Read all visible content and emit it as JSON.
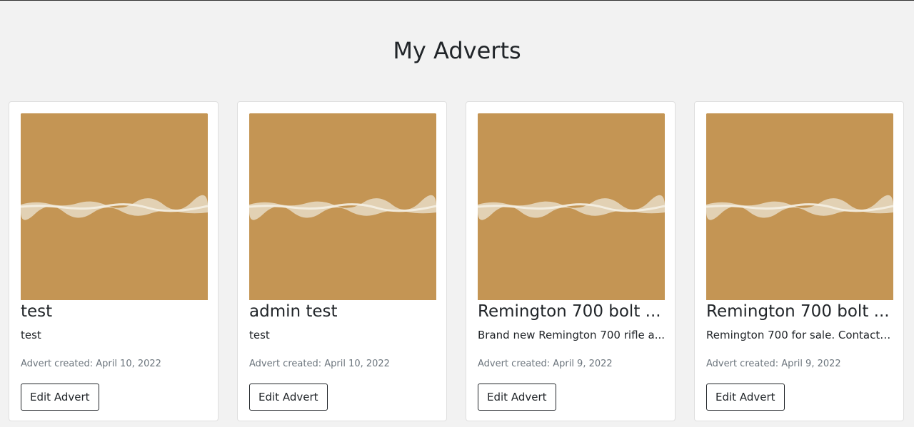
{
  "page": {
    "title": "My Adverts"
  },
  "adverts": [
    {
      "title": "test",
      "description": "test",
      "created": "Advert created: April 10, 2022",
      "edit_label": "Edit Advert"
    },
    {
      "title": "admin test",
      "description": "test",
      "created": "Advert created: April 10, 2022",
      "edit_label": "Edit Advert"
    },
    {
      "title": "Remington 700 bolt ...",
      "description": "Brand new Remington 700 rifle a...",
      "created": "Advert created: April 9, 2022",
      "edit_label": "Edit Advert"
    },
    {
      "title": "Remington 700 bolt ...",
      "description": "Remington 700 for sale. Contact ...",
      "created": "Advert created: April 9, 2022",
      "edit_label": "Edit Advert"
    }
  ],
  "colors": {
    "background": "#f2f2f2",
    "card": "#ffffff",
    "image_tan": "#c49554",
    "muted_text": "#6c757d"
  }
}
